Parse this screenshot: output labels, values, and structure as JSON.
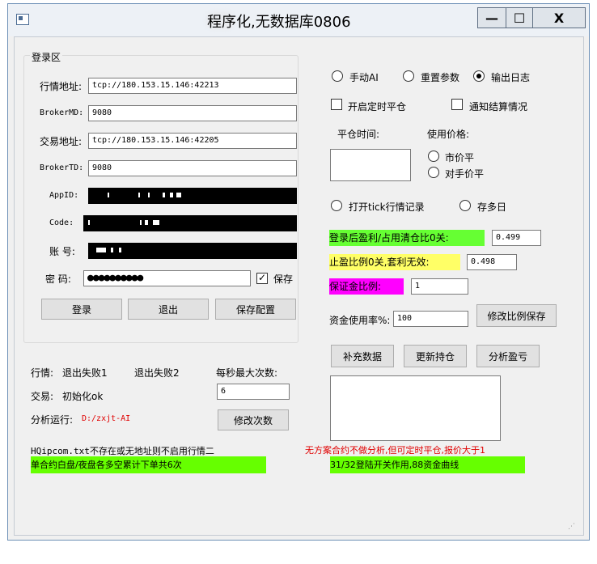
{
  "window": {
    "title": "程序化,无数据库0806",
    "minimize_glyph": "—",
    "maximize_glyph": "☐",
    "close_glyph": "X",
    "icon": "app-icon"
  },
  "login": {
    "group_label": "登录区",
    "market_addr_label": "行情地址:",
    "market_addr_value": "tcp://180.153.15.146:42213",
    "broker_md_label": "BrokerMD:",
    "broker_md_value": "9080",
    "trade_addr_label": "交易地址:",
    "trade_addr_value": "tcp://180.153.15.146:42205",
    "broker_td_label": "BrokerTD:",
    "broker_td_value": "9080",
    "appid_label": "AppID:",
    "code_label": "Code:",
    "account_label": "账  号:",
    "password_label": "密  码:",
    "password_value": "●●●●●●●●●●",
    "save_check_label": "保存",
    "save_checked": true,
    "login_button": "登录",
    "exit_button": "退出",
    "save_config_button": "保存配置"
  },
  "status": {
    "market_label": "行情:",
    "market_status1": "退出失败1",
    "market_status2": "退出失败2",
    "trade_label": "交易:",
    "trade_status": "初始化ok",
    "analysis_label": "分析运行:",
    "analysis_path": "D:/zxjt-AI",
    "max_per_sec_label": "每秒最大次数:",
    "max_per_sec_value": "6",
    "modify_count_button": "修改次数"
  },
  "options": {
    "mode_manual": "手动AI",
    "mode_reset": "重置参数",
    "mode_log": "输出日志",
    "selected_mode": "mode_log",
    "timed_close_label": "开启定时平仓",
    "notify_settle_label": "通知结算情况",
    "close_time_label": "平仓时间:",
    "price_label": "使用价格:",
    "price_market": "市价平",
    "price_counter": "对手价平",
    "tick_record_label": "打开tick行情记录",
    "keep_days_label": "存多日"
  },
  "ratios": {
    "profit_ratio_label": "登录后盈利/占用清仓比0关:",
    "profit_ratio_value": "0.499",
    "profit_ratio_color": "#66ff33",
    "stop_ratio_label": "止盈比例0关,套利无效:",
    "stop_ratio_value": "0.498",
    "stop_ratio_color": "#ffff66",
    "margin_ratio_label": "保证金比例:",
    "margin_ratio_value": "1",
    "margin_ratio_color": "#ff00ff",
    "fund_usage_label": "资金使用率%:",
    "fund_usage_value": "100",
    "save_ratio_button": "修改比例保存"
  },
  "actions": {
    "supplement_button": "补充数据",
    "update_position_button": "更新持仓",
    "analyze_pnl_button": "分析盈亏"
  },
  "footer": {
    "hqipcom_note": "HQipcom.txt不存在或无地址则不启用行情二",
    "no_plan_note": "无方案合约不做分析,但可定时平仓,报价大于1",
    "single_contract_note": "单合约白盘/夜盘各多空累计下单共6次",
    "login_switch_note": "31/32登陆开关作用,88资金曲线",
    "highlight_color": "#66ff00",
    "warning_color": "#e00000"
  }
}
